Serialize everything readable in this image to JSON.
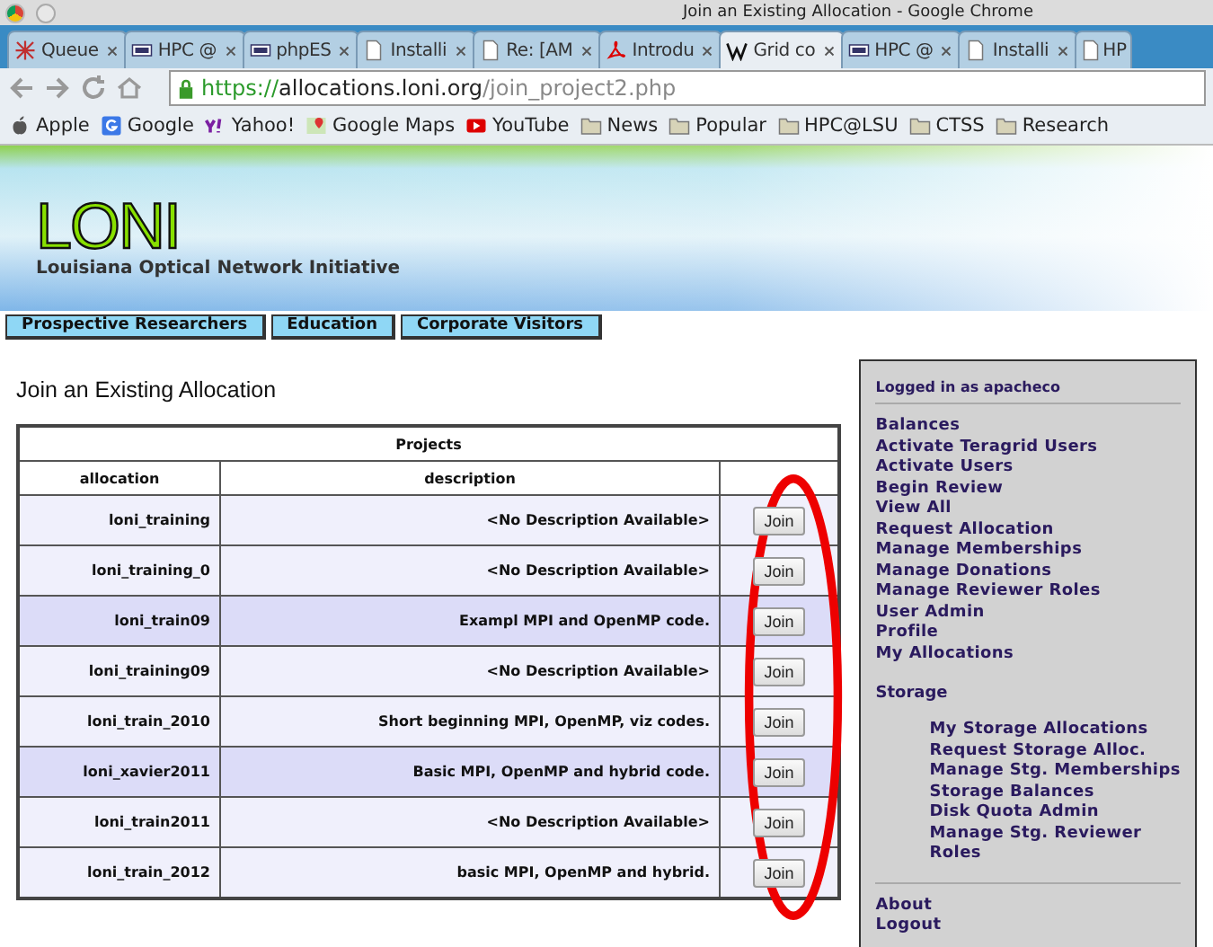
{
  "window": {
    "title": "Join an Existing Allocation - Google Chrome"
  },
  "tabs": [
    {
      "kind": "star",
      "label": "Queue",
      "selected": false
    },
    {
      "kind": "lsu",
      "label": "HPC @",
      "selected": false
    },
    {
      "kind": "lsu",
      "label": "phpES",
      "selected": false
    },
    {
      "kind": "doc",
      "label": "Installi",
      "selected": false
    },
    {
      "kind": "doc",
      "label": "Re: [AM",
      "selected": false
    },
    {
      "kind": "pdf",
      "label": "Introdu",
      "selected": false
    },
    {
      "kind": "wiki",
      "label": "Grid co",
      "selected": true
    },
    {
      "kind": "lsu",
      "label": "HPC @",
      "selected": false
    },
    {
      "kind": "doc",
      "label": "Installi",
      "selected": false
    },
    {
      "kind": "doc",
      "label": "HP",
      "selected": false
    }
  ],
  "address_bar": {
    "scheme": "https://",
    "host": "allocations.loni.org",
    "path": "/join_project2.php"
  },
  "bookmarks": [
    {
      "kind": "apple",
      "label": "Apple"
    },
    {
      "kind": "google",
      "label": "Google"
    },
    {
      "kind": "yahoo",
      "label": "Yahoo!"
    },
    {
      "kind": "maps",
      "label": "Google Maps"
    },
    {
      "kind": "youtube",
      "label": "YouTube"
    },
    {
      "kind": "folder",
      "label": "News"
    },
    {
      "kind": "folder",
      "label": "Popular"
    },
    {
      "kind": "folder",
      "label": "HPC@LSU"
    },
    {
      "kind": "folder",
      "label": "CTSS"
    },
    {
      "kind": "folder",
      "label": "Research"
    }
  ],
  "banner": {
    "logo": "LONI",
    "subtitle": "Louisiana Optical Network Initiative"
  },
  "nav": [
    "Prospective Researchers",
    "Education",
    "Corporate Visitors"
  ],
  "heading": "Join an Existing Allocation",
  "table": {
    "caption": "Projects",
    "columns": [
      "allocation",
      "description"
    ],
    "rows": [
      {
        "allocation": "loni_training",
        "description": "<No Description Available>",
        "action": "Join",
        "highlighted": false
      },
      {
        "allocation": "loni_training_0",
        "description": "<No Description Available>",
        "action": "Join",
        "highlighted": false
      },
      {
        "allocation": "loni_train09",
        "description": "Exampl MPI and OpenMP code.",
        "action": "Join",
        "highlighted": true
      },
      {
        "allocation": "loni_training09",
        "description": "<No Description Available>",
        "action": "Join",
        "highlighted": false
      },
      {
        "allocation": "loni_train_2010",
        "description": "Short beginning MPI, OpenMP, viz codes.",
        "action": "Join",
        "highlighted": false
      },
      {
        "allocation": "loni_xavier2011",
        "description": "Basic MPI, OpenMP and hybrid code.",
        "action": "Join",
        "highlighted": true
      },
      {
        "allocation": "loni_train2011",
        "description": "<No Description Available>",
        "action": "Join",
        "highlighted": false
      },
      {
        "allocation": "loni_train_2012",
        "description": "basic MPI, OpenMP and hybrid.",
        "action": "Join",
        "highlighted": false
      }
    ]
  },
  "sidebar": {
    "user": "Logged in as apacheco",
    "links": [
      "Balances",
      "Activate Teragrid Users",
      "Activate Users",
      "Begin Review",
      "View All",
      "Request Allocation",
      "Manage Memberships",
      "Manage Donations",
      "Manage Reviewer Roles",
      "User Admin",
      "Profile",
      "My Allocations"
    ],
    "storage_heading": "Storage",
    "storage_links": [
      "My Storage Allocations",
      "Request Storage Alloc.",
      "Manage Stg. Memberships",
      "Storage Balances",
      "Disk Quota Admin",
      "Manage Stg. Reviewer Roles"
    ],
    "footer_links": [
      "About",
      "Logout"
    ]
  }
}
